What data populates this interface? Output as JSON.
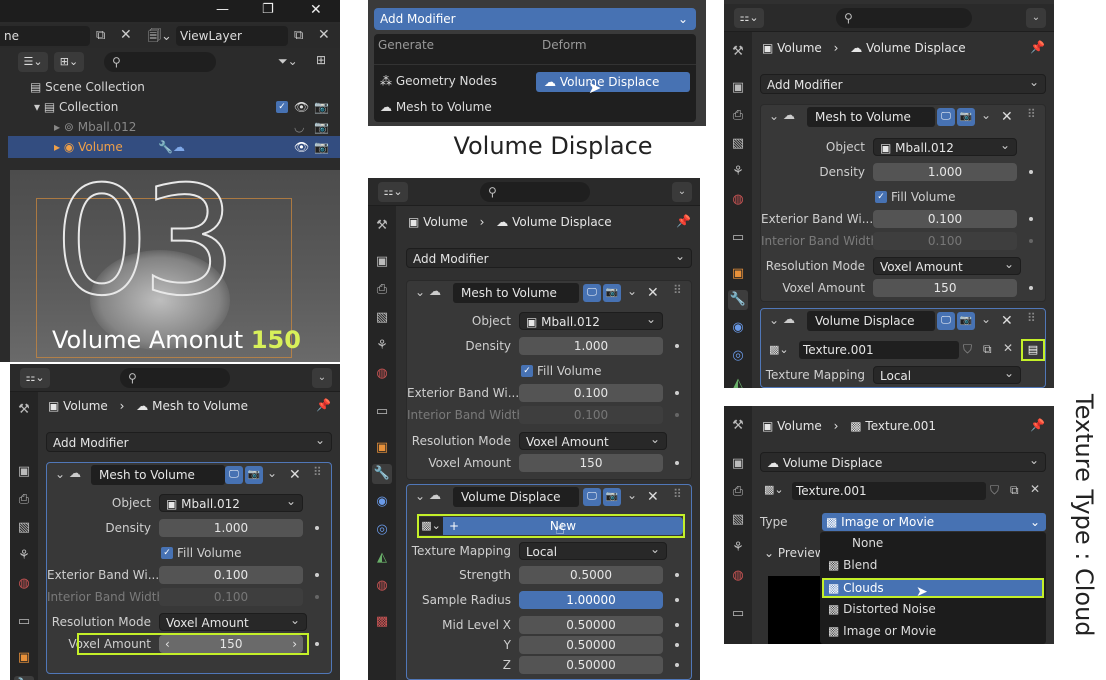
{
  "window": {
    "title_tail": "ne",
    "view_layer": "ViewLayer",
    "minimize": "—",
    "maximize": "❐",
    "close": "✕"
  },
  "outliner": {
    "scene_collection": "Scene Collection",
    "collection": "Collection",
    "items": [
      {
        "label": "Mball.012"
      },
      {
        "label": "Volume"
      }
    ]
  },
  "viewport": {
    "big_number": "03",
    "caption_prefix": "Volume Amonut",
    "caption_value": "150"
  },
  "accent_colors": {
    "highlight": "#c4f029",
    "selection": "#4772b3",
    "active_row": "#334d80",
    "volume_orange": "#e8a04a"
  },
  "add_modifier_menu": {
    "button": "Add Modifier",
    "col1": "Generate",
    "col2": "Deform",
    "items": [
      "Geometry Nodes",
      "Mesh to Volume"
    ],
    "selected": "Volume Displace"
  },
  "center_title": "Volume Displace",
  "side_title": "Texture Type : Cloud",
  "props": {
    "crumb_object": "Volume",
    "crumb_mod_mtv": "Mesh to Volume",
    "crumb_mod_vd": "Volume Displace",
    "add_modifier": "Add Modifier",
    "mtv": {
      "name": "Mesh to Volume",
      "object_label": "Object",
      "object_value": "Mball.012",
      "density_label": "Density",
      "density_value": "1.000",
      "fill_label": "Fill Volume",
      "ext_label": "Exterior Band Wi...",
      "ext_value": "0.100",
      "int_label": "Interior Band Width",
      "int_value": "0.100",
      "res_label": "Resolution Mode",
      "res_value": "Voxel Amount",
      "vox_label": "Voxel Amount",
      "vox_value": "150"
    },
    "vd": {
      "name": "Volume Displace",
      "new_label": "New",
      "map_label": "Texture Mapping",
      "map_value": "Local",
      "strength_label": "Strength",
      "strength_value": "0.5000",
      "radius_label": "Sample Radius",
      "radius_value": "1.00000",
      "midx_label": "Mid Level X",
      "midx_value": "0.50000",
      "y_label": "Y",
      "y_value": "0.50000",
      "z_label": "Z",
      "z_value": "0.50000",
      "texture": "Texture.001"
    }
  },
  "texture_panel": {
    "crumb_object": "Volume",
    "crumb_texture": "Texture.001",
    "modifier": "Volume Displace",
    "texture": "Texture.001",
    "type_label": "Type",
    "type_value": "Image or Movie",
    "preview": "Preview",
    "options": [
      "None",
      "Blend",
      "Clouds",
      "Distorted Noise",
      "Image or Movie"
    ],
    "selected_option": "Clouds"
  }
}
